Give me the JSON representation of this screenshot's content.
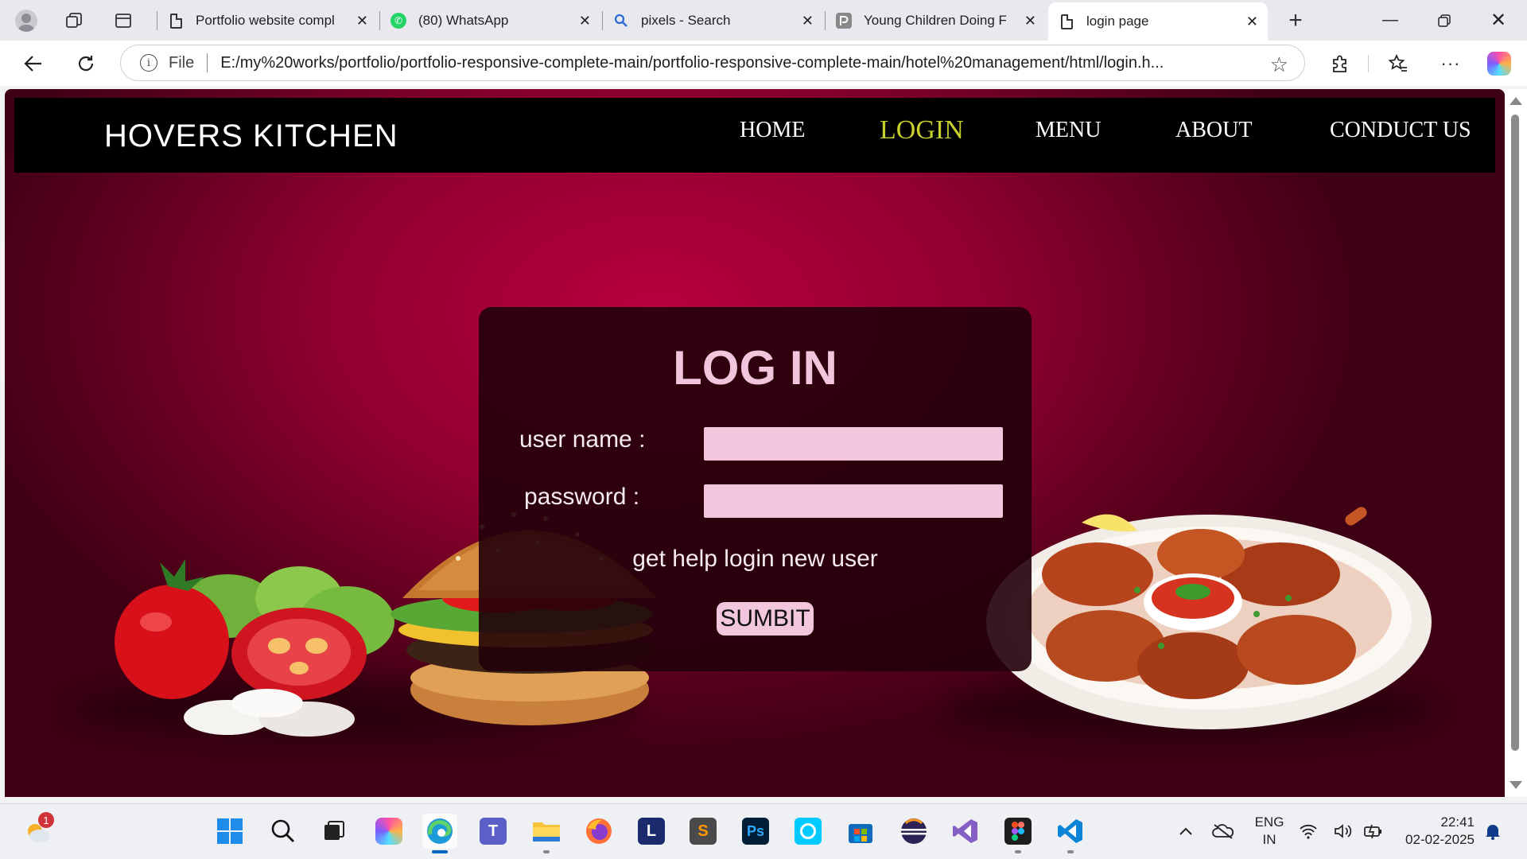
{
  "browser": {
    "tabs": [
      {
        "title": "Portfolio website compl",
        "icon": "page-icon",
        "active": false
      },
      {
        "title": "(80) WhatsApp",
        "icon": "whatsapp-icon",
        "active": false
      },
      {
        "title": "pixels - Search",
        "icon": "search-icon",
        "active": false
      },
      {
        "title": "Young Children Doing F",
        "icon": "pexels-icon",
        "active": false
      },
      {
        "title": "login page",
        "icon": "page-icon",
        "active": true
      }
    ],
    "address": {
      "scheme_label": "File",
      "url": "E:/my%20works/portfolio/portfolio-responsive-complete-main/portfolio-responsive-complete-main/hotel%20management/html/login.h..."
    }
  },
  "site": {
    "brand": "HOVERS KITCHEN",
    "nav": [
      {
        "label": "HOME",
        "current": false
      },
      {
        "label": "LOGIN",
        "current": true
      },
      {
        "label": "MENU",
        "current": false
      },
      {
        "label": "ABOUT",
        "current": false
      },
      {
        "label": "CONDUCT US",
        "current": false
      }
    ],
    "accent_color": "#c7cf2c",
    "background_color": "#a8003a"
  },
  "login": {
    "title": "LOG IN",
    "username_label": "user name :",
    "password_label": "password :",
    "username_value": "",
    "password_value": "",
    "help_text": "get help login new user",
    "submit_label": "SUMBIT"
  },
  "taskbar": {
    "weather_badge": "1",
    "apps": [
      "start-icon",
      "search-icon",
      "task-view-icon",
      "copilot-icon",
      "edge-icon",
      "teams-icon",
      "file-explorer-icon",
      "firefox-icon",
      "l-app-icon",
      "sublime-icon",
      "photoshop-icon",
      "alexa-icon",
      "store-icon",
      "eclipse-icon",
      "visual-studio-icon",
      "figma-icon",
      "vscode-icon"
    ],
    "tray": {
      "language_line1": "ENG",
      "language_line2": "IN",
      "time": "22:41",
      "date": "02-02-2025"
    }
  }
}
